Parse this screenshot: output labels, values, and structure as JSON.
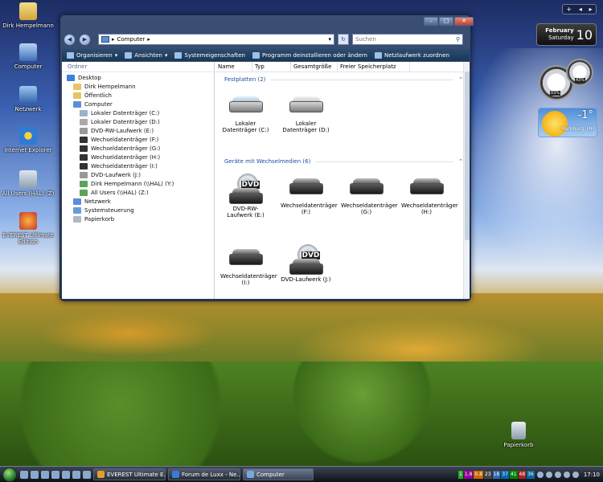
{
  "desktop": {
    "icons": [
      {
        "name": "folder-icon",
        "label": "Dirk Hempelmann"
      },
      {
        "name": "computer-icon",
        "label": "Computer"
      },
      {
        "name": "network-icon",
        "label": "Netzwerk"
      },
      {
        "name": "ie-icon",
        "label": "Internet Explorer"
      },
      {
        "name": "network-drive-icon",
        "label": "All Users (HAL) (Z)"
      },
      {
        "name": "everest-icon",
        "label": "EVEREST Ultimate Edition"
      }
    ],
    "recycle_bin": "Papierkorb"
  },
  "window": {
    "address": "Computer",
    "search_placeholder": "Suchen",
    "toolbar": [
      "Organisieren",
      "Ansichten",
      "Systemeigenschaften",
      "Programm deinstallieren oder ändern",
      "Netzlaufwerk zuordnen"
    ],
    "nav_header": "Ordner",
    "tree": [
      {
        "label": "Desktop",
        "color": "#3d7fd9"
      },
      {
        "label": "Dirk Hempelmann",
        "color": "#e7c465"
      },
      {
        "label": "Öffentlich",
        "color": "#e7c465"
      },
      {
        "label": "Computer",
        "color": "#5d8fd4"
      },
      {
        "label": "Lokaler Datenträger (C:)",
        "color": "#9bb3c9"
      },
      {
        "label": "Lokaler Datenträger (D:)",
        "color": "#aaaaaa"
      },
      {
        "label": "DVD-RW-Laufwerk (E:)",
        "color": "#999999"
      },
      {
        "label": "Wechseldatenträger (F:)",
        "color": "#333333"
      },
      {
        "label": "Wechseldatenträger (G:)",
        "color": "#333333"
      },
      {
        "label": "Wechseldatenträger (H:)",
        "color": "#333333"
      },
      {
        "label": "Wechseldatenträger (I:)",
        "color": "#333333"
      },
      {
        "label": "DVD-Laufwerk (J:)",
        "color": "#999999"
      },
      {
        "label": "Dirk Hempelmann (\\\\HAL) (Y:)",
        "color": "#5aa35a"
      },
      {
        "label": "All Users (\\\\HAL) (Z:)",
        "color": "#5aa35a"
      },
      {
        "label": "Netzwerk",
        "color": "#5d8fd4"
      },
      {
        "label": "Systemsteuerung",
        "color": "#6b9bd8"
      },
      {
        "label": "Papierkorb",
        "color": "#b0b8c2"
      }
    ],
    "columns": [
      "Name",
      "Typ",
      "Gesamtgröße",
      "Freier Speicherplatz"
    ],
    "groups": [
      {
        "title": "Festplatten (2)",
        "items": [
          {
            "label": "Lokaler Datenträger (C:)",
            "kind": "sys"
          },
          {
            "label": "Lokaler Datenträger (D:)",
            "kind": "plain"
          }
        ]
      },
      {
        "title": "Geräte mit Wechselmedien (6)",
        "items": [
          {
            "label": "DVD-RW-Laufwerk (E:)",
            "kind": "dvd"
          },
          {
            "label": "Wechseldatenträger (F:)",
            "kind": "dark"
          },
          {
            "label": "Wechseldatenträger (G:)",
            "kind": "dark"
          },
          {
            "label": "Wechseldatenträger (H:)",
            "kind": "dark"
          },
          {
            "label": "Wechseldatenträger (I:)",
            "kind": "dark"
          },
          {
            "label": "DVD-Laufwerk (J:)",
            "kind": "dvd"
          }
        ]
      }
    ],
    "dvd_text": "DVD"
  },
  "gadgets": {
    "month": "February",
    "weekday": "Saturday",
    "day": "10",
    "meter1": "03%",
    "meter2": "43%",
    "temp": "-1°",
    "city": "Hamburg, HH"
  },
  "taskbar": {
    "tasks": [
      "EVEREST Ultimate E...",
      "Forum de Luxx - Ne...",
      "Computer"
    ],
    "tray": [
      "1",
      "1.8",
      "0.8",
      "23",
      "18",
      "37",
      "41",
      "48",
      "36"
    ],
    "time": "17:10"
  }
}
